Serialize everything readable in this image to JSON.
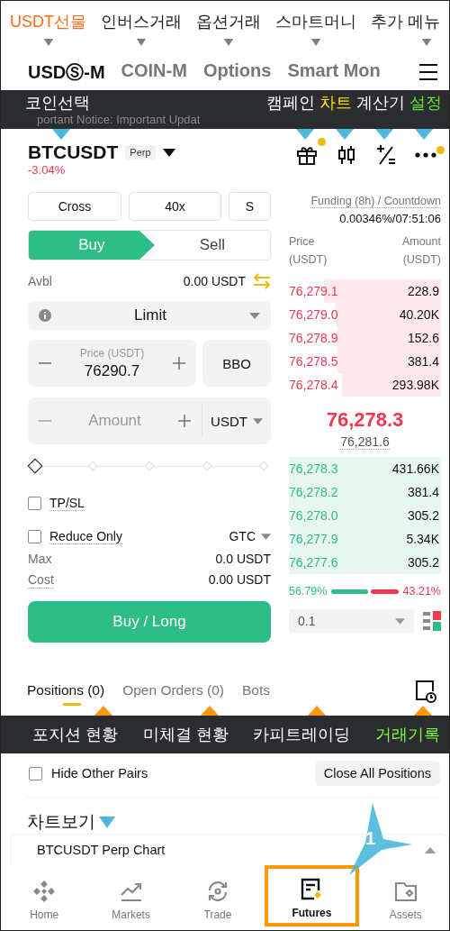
{
  "top_annotations": [
    {
      "label": "USDT선물",
      "color": "#ff6a13"
    },
    {
      "label": "인버스거래",
      "color": "#222222"
    },
    {
      "label": "옵션거래",
      "color": "#222222"
    },
    {
      "label": "스마트머니",
      "color": "#222222"
    },
    {
      "label": "추가 메뉴",
      "color": "#222222"
    }
  ],
  "market_tabs": [
    {
      "label": "USDⓈ-M",
      "selected": true
    },
    {
      "label": "COIN-M",
      "selected": false
    },
    {
      "label": "Options",
      "selected": false
    },
    {
      "label": "Smart Mon",
      "selected": false
    }
  ],
  "toolbar_annotation": {
    "left": "코인선택",
    "notice": "portant Notice: Important Updat",
    "right": [
      {
        "label": "캠페인",
        "color": "#ffffff"
      },
      {
        "label": "차트",
        "color": "#ffe500"
      },
      {
        "label": "계산기",
        "color": "#ffffff"
      },
      {
        "label": "설정",
        "color": "#66dd33"
      }
    ]
  },
  "symbol": {
    "name": "BTCUSDT",
    "badge": "Perp",
    "change": "-3.04%"
  },
  "header_icons": [
    {
      "kind": "gift",
      "notification": true
    },
    {
      "kind": "chart",
      "notification": false
    },
    {
      "kind": "calculator",
      "notification": false
    },
    {
      "kind": "more",
      "notification": true
    }
  ],
  "order_form": {
    "margin_mode": "Cross",
    "leverage": "40x",
    "asset_mode": "S",
    "sides": [
      {
        "label": "Buy",
        "selected": true
      },
      {
        "label": "Sell",
        "selected": false
      }
    ],
    "avbl_label": "Avbl",
    "avbl_value": "0.00 USDT",
    "order_type": "Limit",
    "price": {
      "label": "Price (USDT)",
      "value": "76290.7"
    },
    "bbo": "BBO",
    "amount": {
      "placeholder": "Amount",
      "unit": "USDT"
    },
    "slider": {
      "level": 0
    },
    "tpsl": {
      "label": "TP/SL",
      "checked": false
    },
    "reduce_only": {
      "label": "Reduce Only",
      "checked": false
    },
    "time_in_force": "GTC",
    "max_label": "Max",
    "max_value": "0.0 USDT",
    "cost_label": "Cost",
    "cost_value": "0.00 USDT",
    "submit": "Buy / Long"
  },
  "orderbook": {
    "funding_label": "Funding (8h) / Countdown",
    "funding_value": "0.00346%/07:51:06",
    "price_header": [
      "Price",
      "(USDT)"
    ],
    "amount_header": [
      "Amount",
      "(USDT)"
    ],
    "asks": [
      {
        "price": "76,279.1",
        "amount": "228.9"
      },
      {
        "price": "76,279.0",
        "amount": "40.20K"
      },
      {
        "price": "76,278.9",
        "amount": "152.6"
      },
      {
        "price": "76,278.5",
        "amount": "381.4"
      },
      {
        "price": "76,278.4",
        "amount": "293.98K"
      }
    ],
    "last_price": "76,278.3",
    "mark_price": "76,281.6",
    "bids": [
      {
        "price": "76,278.3",
        "amount": "431.66K"
      },
      {
        "price": "76,278.2",
        "amount": "381.4"
      },
      {
        "price": "76,278.0",
        "amount": "305.2"
      },
      {
        "price": "76,277.9",
        "amount": "5.34K"
      },
      {
        "price": "76,277.6",
        "amount": "305.2"
      }
    ],
    "buy_ratio": "56.79%",
    "sell_ratio": "43.21%",
    "ratio": {
      "level": 0.5679
    },
    "precision": "0.1"
  },
  "position_tabs": [
    {
      "label": "Positions (0)",
      "selected": true
    },
    {
      "label": "Open Orders (0)",
      "selected": false
    },
    {
      "label": "Bots",
      "selected": false
    }
  ],
  "bottom_annotations": [
    {
      "label": "포지션 현황",
      "color": "#ffffff"
    },
    {
      "label": "미체결 현황",
      "color": "#ffffff"
    },
    {
      "label": "카피트레이딩",
      "color": "#ffffff"
    },
    {
      "label": "거래기록",
      "color": "#7cfc3a"
    }
  ],
  "hide_other_pairs": {
    "label": "Hide Other Pairs",
    "checked": false
  },
  "close_all": "Close All Positions",
  "chart_annotation": "차트보기",
  "chart_panel": {
    "title": "BTCUSDT Perp Chart",
    "expanded": false
  },
  "callout": "1",
  "nav": [
    {
      "kind": "home",
      "label": "Home",
      "selected": false,
      "highlighted": false
    },
    {
      "kind": "markets",
      "label": "Markets",
      "selected": false,
      "highlighted": false
    },
    {
      "kind": "trade",
      "label": "Trade",
      "selected": false,
      "highlighted": false
    },
    {
      "kind": "futures",
      "label": "Futures",
      "selected": true,
      "highlighted": true
    },
    {
      "kind": "assets",
      "label": "Assets",
      "selected": false,
      "highlighted": false
    }
  ]
}
